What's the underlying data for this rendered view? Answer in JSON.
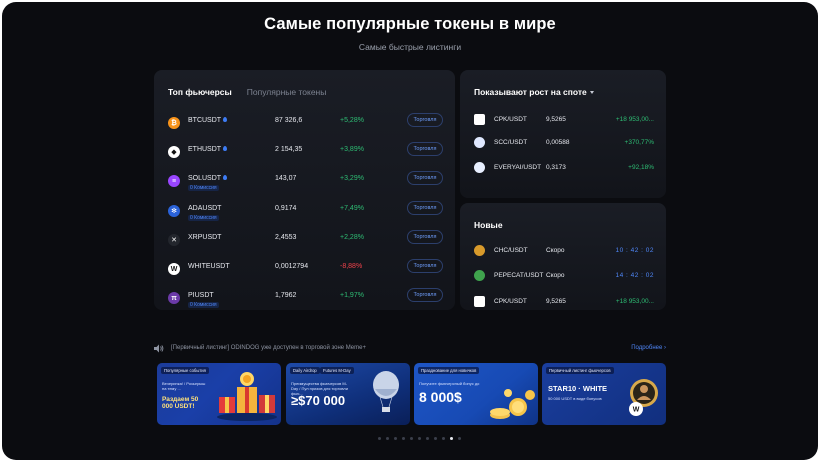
{
  "header": {
    "title": "Самые популярные токены в мире",
    "subtitle": "Самые быстрые листинги"
  },
  "futures_panel": {
    "tabs": [
      "Топ фьючерсы",
      "Популярные токены"
    ],
    "rows": [
      {
        "symbol": "BTCUSDT",
        "price": "87 326,6",
        "change": "+5,28%",
        "badge": "",
        "icon": "bitcoin-icon",
        "color": "#f7931a",
        "hot": true
      },
      {
        "symbol": "ETHUSDT",
        "price": "2 154,35",
        "change": "+3,89%",
        "badge": "",
        "icon": "ethereum-icon",
        "color": "#ffffff",
        "hot": true
      },
      {
        "symbol": "SOLUSDT",
        "price": "143,07",
        "change": "+3,29%",
        "badge": "0 Комиссия",
        "icon": "solana-icon",
        "color": "#9945ff",
        "hot": true
      },
      {
        "symbol": "ADAUSDT",
        "price": "0,9174",
        "change": "+7,49%",
        "badge": "0 Комиссия",
        "icon": "cardano-icon",
        "color": "#2a62d8",
        "hot": false
      },
      {
        "symbol": "XRPUSDT",
        "price": "2,4553",
        "change": "+2,28%",
        "badge": "",
        "icon": "xrp-icon",
        "color": "#23262d",
        "hot": false
      },
      {
        "symbol": "WHITEUSDT",
        "price": "0,0012794",
        "change": "-8,88%",
        "badge": "",
        "icon": "white-token-icon",
        "color": "#ffffff",
        "hot": false
      },
      {
        "symbol": "PIUSDT",
        "price": "1,7962",
        "change": "+1,97%",
        "badge": "0 Комиссия",
        "icon": "pi-network-icon",
        "color": "#6b3aa8",
        "hot": false
      }
    ],
    "trade_label": "Торговля"
  },
  "spot_growth_panel": {
    "title": "Показывают рост на споте",
    "rows": [
      {
        "symbol": "CPK/USDT",
        "price": "9,5265",
        "change": "+18 953,00...",
        "icon": "cpk-icon"
      },
      {
        "symbol": "SCC/USDT",
        "price": "0,00588",
        "change": "+370,77%",
        "icon": "scc-icon"
      },
      {
        "symbol": "EVERYAI/USDT",
        "price": "0,3173",
        "change": "+92,18%",
        "icon": "everyai-icon"
      }
    ]
  },
  "new_panel": {
    "title": "Новые",
    "rows": [
      {
        "symbol": "CHC/USDT",
        "price": "Скоро",
        "value": "10 : 42 : 02",
        "type": "time",
        "icon": "chc-icon"
      },
      {
        "symbol": "PEPECAT/USDT",
        "price": "Скоро",
        "value": "14 : 42 : 02",
        "type": "time",
        "icon": "pepecat-icon"
      },
      {
        "symbol": "CPK/USDT",
        "price": "9,5265",
        "value": "+18 953,00...",
        "type": "change",
        "icon": "cpk-icon"
      }
    ]
  },
  "ticker": {
    "text": "[Первичный листинг] ODINDOG уже доступен в торговой зоне Meme+",
    "more": "Подробнее"
  },
  "banners": [
    {
      "tags": [
        "Популярные события"
      ],
      "small": "Вечеринка! / Розыгрыш на тему ...",
      "big": "Раздаем 50 000 USDT!"
    },
    {
      "tags": [
        "Daily Airdrop",
        "Futures M-Day"
      ],
      "small": "Преимущества фьючерсов M-Day / Пул призов для торговли фью...",
      "big": "≥$70 000"
    },
    {
      "tags": [
        "Празднование для новичков"
      ],
      "small": "Получите фьючерсный бонус до",
      "big": "8 000$"
    },
    {
      "tags": [
        "Первичный листинг фьючерсов"
      ],
      "small": "50 000 USDT в виде бонусов",
      "big": "STAR10 · WHITE"
    }
  ],
  "pagination": {
    "count": 11,
    "active_index": 9
  },
  "colors": {
    "up": "#2ebd74",
    "down": "#f2434b",
    "accent": "#4f86f7"
  }
}
